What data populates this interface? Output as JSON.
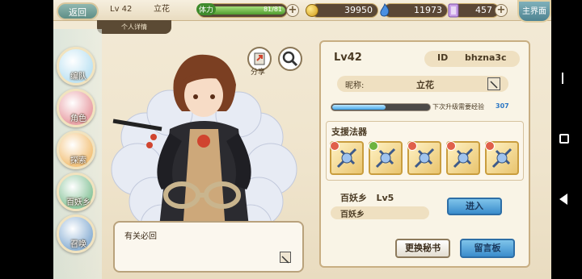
{
  "header": {
    "back_label": "返回",
    "sub_tab": "个人详情",
    "level": "Lv 42",
    "player_name": "立花",
    "stamina_label": "体力",
    "stamina_value": "81/81",
    "stamina_fraction": 1.0,
    "gold": "39950",
    "gems": "11973",
    "tickets": "457",
    "home_label": "主界面"
  },
  "left_menu": [
    {
      "label": "编队",
      "color": "#bfe3f3"
    },
    {
      "label": "角色",
      "color": "#e9a2a8"
    },
    {
      "label": "探索",
      "color": "#f3c47f"
    },
    {
      "label": "百妖乡",
      "color": "#8fc7a0"
    },
    {
      "label": "召唤",
      "color": "#8fb3d6"
    }
  ],
  "actions": {
    "share_label": "分享"
  },
  "speech": {
    "text": "有关必回"
  },
  "profile": {
    "level": "Lv42",
    "id_label": "ID",
    "id_value": "bhzna3c",
    "nickname_label": "昵称:",
    "nickname_value": "立花",
    "exp_label": "下次升级需要经验",
    "exp_value": "307",
    "exp_fraction": 0.55,
    "support_title": "支援法器",
    "weapons": [
      {
        "badge_color": "#e0604a"
      },
      {
        "badge_color": "#6db33f"
      },
      {
        "badge_color": "#e0604a"
      },
      {
        "badge_color": "#e0604a"
      },
      {
        "badge_color": "#e0604a"
      }
    ],
    "village_line": "百妖乡   Lv5",
    "village_name": "百妖乡",
    "enter_label": "进入",
    "change_secretary_label": "更换秘书",
    "message_board_label": "留言板"
  },
  "colors": {
    "gold": "#f1c232",
    "gem": "#4a90e2",
    "ticket": "#c9a0e8",
    "stamina": "#6fbf4a"
  }
}
